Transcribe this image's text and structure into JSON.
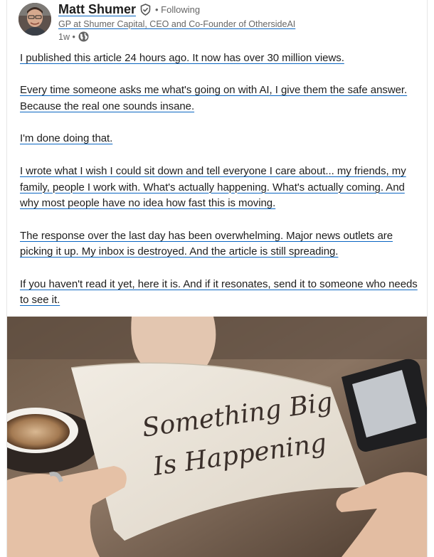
{
  "author": {
    "name": "Matt Shumer",
    "follow_status": "• Following",
    "headline": "GP at Shumer Capital, CEO and Co-Founder of OthersideAI",
    "timestamp": "1w •"
  },
  "icons": {
    "verified": "verified-shield-icon",
    "visibility": "globe-icon"
  },
  "post": {
    "paragraphs": [
      "I published this article 24 hours ago. It now has over 30 million views.",
      "Every time someone asks me what's going on with AI, I give them the safe answer. Because the real one sounds insane.",
      "I'm done doing that.",
      "I wrote what I wish I could sit down and tell everyone I care about... my friends, my family, people I work with. What's actually happening. What's actually coming. And why most people have no idea how fast this is moving.",
      "The response over the last day has been overwhelming. Major news outlets are picking it up. My inbox is destroyed. And the article is still spreading.",
      "If you haven't read it yet, here it is. And if it resonates, send it to someone who needs to see it."
    ]
  },
  "image": {
    "card_text_line1": "Something Big",
    "card_text_line2": "Is Happening"
  },
  "colors": {
    "link_underline": "#0a66c2",
    "secondary_text": "#666666",
    "primary_text": "#1d1d1d"
  }
}
